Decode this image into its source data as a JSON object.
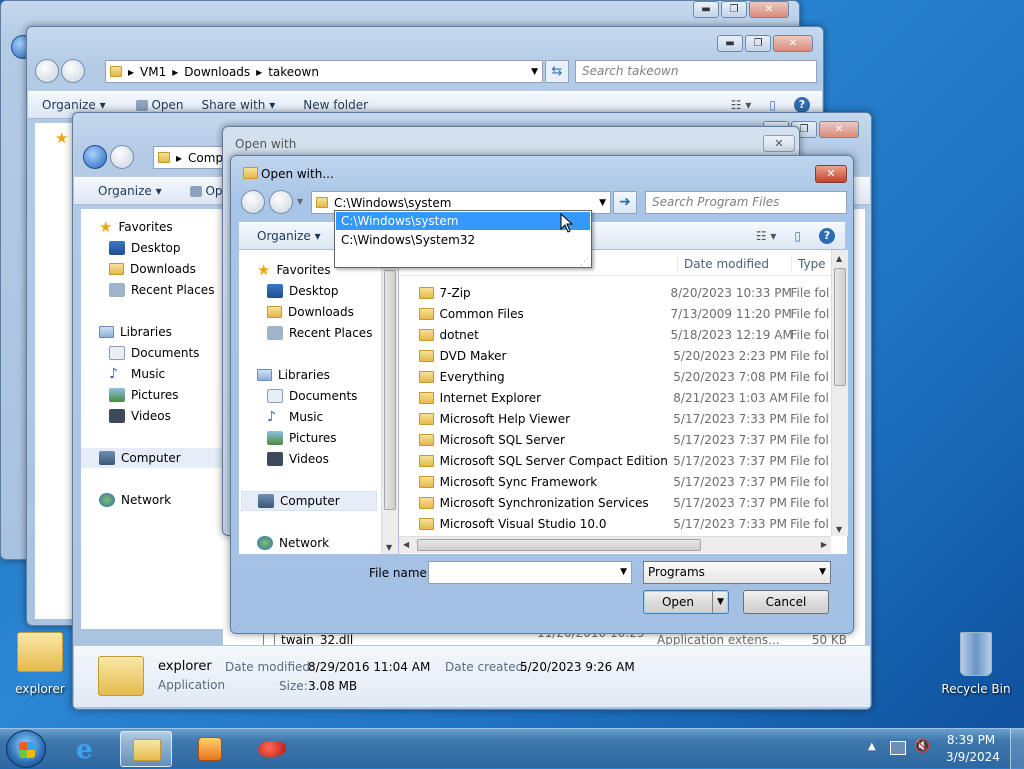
{
  "back_window": {
    "controls": [
      "▬",
      "❐",
      "✕"
    ]
  },
  "explorer_window_1": {
    "breadcrumb": [
      "VM1",
      "Downloads",
      "takeown"
    ],
    "search_placeholder": "Search takeown",
    "toolbar": {
      "organize": "Organize",
      "open": "Open",
      "share_with": "Share with",
      "new_folder": "New folder"
    },
    "controls": [
      "▬",
      "❐",
      "✕"
    ]
  },
  "explorer_window_2": {
    "breadcrumb_partial": "Comp",
    "toolbar": {
      "organize": "Organize",
      "open_partial": "Op"
    },
    "nav": {
      "favorites": "Favorites",
      "desktop": "Desktop",
      "downloads": "Downloads",
      "recent_places": "Recent Places",
      "libraries": "Libraries",
      "documents": "Documents",
      "music": "Music",
      "pictures": "Pictures",
      "videos": "Videos",
      "computer": "Computer",
      "network": "Network"
    },
    "file_row": {
      "name": "twain_32.dll",
      "date": "11/20/2010 10:25 ...",
      "type": "Application extens...",
      "size": "50 KB"
    },
    "details": {
      "name": "explorer",
      "kind": "Application",
      "date_modified_label": "Date modified:",
      "date_modified": "8/29/2016 11:04 AM",
      "date_created_label": "Date created:",
      "date_created": "5/20/2023 9:26 AM",
      "size_label": "Size:",
      "size": "3.08 MB"
    },
    "controls": [
      "▬",
      "❐",
      "✕"
    ]
  },
  "open_with_back": {
    "title": "Open with",
    "close": "✕"
  },
  "open_with_dialog": {
    "title": "Open with...",
    "address": "C:\\Windows\\system",
    "search_placeholder": "Search Program Files",
    "dropdown_options": [
      "C:\\Windows\\system",
      "C:\\Windows\\System32"
    ],
    "toolbar": {
      "organize": "Organize"
    },
    "nav": {
      "favorites": "Favorites",
      "desktop": "Desktop",
      "downloads": "Downloads",
      "recent_places": "Recent Places",
      "libraries": "Libraries",
      "documents": "Documents",
      "music": "Music",
      "pictures": "Pictures",
      "videos": "Videos",
      "computer": "Computer",
      "network": "Network"
    },
    "columns": {
      "date_modified": "Date modified",
      "type": "Type"
    },
    "files": [
      {
        "name": "7-Zip",
        "date": "8/20/2023 10:33 PM",
        "type": "File fol"
      },
      {
        "name": "Common Files",
        "date": "7/13/2009 11:20 PM",
        "type": "File fol"
      },
      {
        "name": "dotnet",
        "date": "5/18/2023 12:19 AM",
        "type": "File fol"
      },
      {
        "name": "DVD Maker",
        "date": "5/20/2023 2:23 PM",
        "type": "File fol"
      },
      {
        "name": "Everything",
        "date": "5/20/2023 7:08 PM",
        "type": "File fol"
      },
      {
        "name": "Internet Explorer",
        "date": "8/21/2023 1:03 AM",
        "type": "File fol"
      },
      {
        "name": "Microsoft Help Viewer",
        "date": "5/17/2023 7:33 PM",
        "type": "File fol"
      },
      {
        "name": "Microsoft SQL Server",
        "date": "5/17/2023 7:37 PM",
        "type": "File fol"
      },
      {
        "name": "Microsoft SQL Server Compact Edition",
        "date": "5/17/2023 7:37 PM",
        "type": "File fol"
      },
      {
        "name": "Microsoft Sync Framework",
        "date": "5/17/2023 7:37 PM",
        "type": "File fol"
      },
      {
        "name": "Microsoft Synchronization Services",
        "date": "5/17/2023 7:37 PM",
        "type": "File fol"
      },
      {
        "name": "Microsoft Visual Studio 10.0",
        "date": "5/17/2023 7:33 PM",
        "type": "File fol"
      }
    ],
    "file_name_label": "File name:",
    "file_name_value": "",
    "filter": "Programs",
    "open_button": "Open",
    "cancel_button": "Cancel"
  },
  "desktop": {
    "explorer_icon_label": "explorer",
    "recycle_bin_label": "Recycle Bin"
  },
  "taskbar": {
    "time": "8:39 PM",
    "date": "3/9/2024"
  },
  "colors": {
    "selection": "#cce8ff",
    "dropdown_highlight": "#3399ff",
    "title_text": "#1e395b"
  }
}
